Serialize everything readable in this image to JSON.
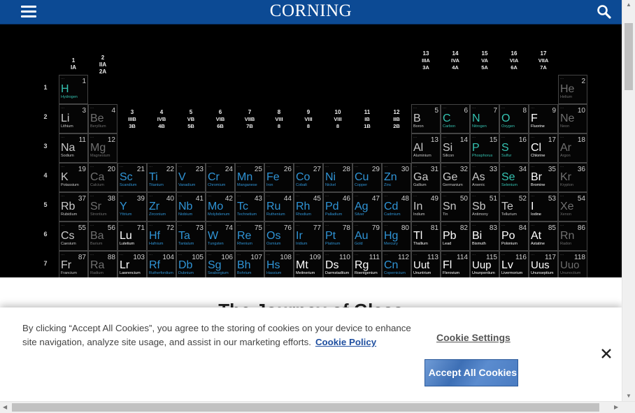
{
  "header": {
    "logo_text": "CORNING",
    "menu_icon": "hamburger-icon",
    "search_icon": "search-icon",
    "bar_color": "#0c4a94"
  },
  "periodic_table": {
    "colors": {
      "default": "#c9c9c9",
      "teal": "#35c3b2",
      "blue": "#2f94d6",
      "white": "#ffffff",
      "dim": "#6f6f6f"
    },
    "group_labels": [
      {
        "col": 1,
        "num": "1",
        "roman": "IA",
        "ab": "",
        "row": 0
      },
      {
        "col": 2,
        "num": "",
        "roman": "IIA",
        "ab": "2A",
        "row": 0
      },
      {
        "col": 3,
        "num": "3",
        "roman": "IIIB",
        "ab": "3B",
        "row": 2
      },
      {
        "col": 4,
        "num": "4",
        "roman": "IVB",
        "ab": "4B",
        "row": 2
      },
      {
        "col": 5,
        "num": "5",
        "roman": "VB",
        "ab": "5B",
        "row": 2
      },
      {
        "col": 6,
        "num": "6",
        "roman": "VIB",
        "ab": "6B",
        "row": 2
      },
      {
        "col": 7,
        "num": "7",
        "roman": "VIIB",
        "ab": "7B",
        "row": 2
      },
      {
        "col": 8,
        "num": "8",
        "roman": "VIII",
        "ab": "8",
        "row": 2
      },
      {
        "col": 9,
        "num": "9",
        "roman": "VIII",
        "ab": "8",
        "row": 2
      },
      {
        "col": 10,
        "num": "10",
        "roman": "VIII",
        "ab": "8",
        "row": 2
      },
      {
        "col": 11,
        "num": "11",
        "roman": "IB",
        "ab": "1B",
        "row": 2
      },
      {
        "col": 12,
        "num": "12",
        "roman": "IIB",
        "ab": "2B",
        "row": 2
      },
      {
        "col": 13,
        "num": "13",
        "roman": "IIIA",
        "ab": "3A",
        "row": 1
      },
      {
        "col": 14,
        "num": "14",
        "roman": "IVA",
        "ab": "4A",
        "row": 1
      },
      {
        "col": 15,
        "num": "15",
        "roman": "VA",
        "ab": "5A",
        "row": 1
      },
      {
        "col": 16,
        "num": "16",
        "roman": "VIA",
        "ab": "6A",
        "row": 1
      },
      {
        "col": 17,
        "num": "17",
        "roman": "VIIA",
        "ab": "7A",
        "row": 1
      }
    ],
    "period_labels": [
      "1",
      "2",
      "3",
      "4",
      "5",
      "6",
      "7"
    ],
    "elements": [
      {
        "sym": "H",
        "num": "1",
        "name": "Hydrogen",
        "r": 1,
        "c": 1,
        "t": "teal"
      },
      {
        "sym": "He",
        "num": "2",
        "name": "Helium",
        "r": 1,
        "c": 18,
        "t": "dim"
      },
      {
        "sym": "Li",
        "num": "3",
        "name": "Lithium",
        "r": 2,
        "c": 1,
        "t": "default"
      },
      {
        "sym": "Be",
        "num": "4",
        "name": "Beryllium",
        "r": 2,
        "c": 2,
        "t": "dim"
      },
      {
        "sym": "B",
        "num": "5",
        "name": "Boron",
        "r": 2,
        "c": 13,
        "t": "default"
      },
      {
        "sym": "C",
        "num": "6",
        "name": "Carbon",
        "r": 2,
        "c": 14,
        "t": "teal"
      },
      {
        "sym": "N",
        "num": "7",
        "name": "Nitrogen",
        "r": 2,
        "c": 15,
        "t": "teal"
      },
      {
        "sym": "O",
        "num": "8",
        "name": "Oxygen",
        "r": 2,
        "c": 16,
        "t": "teal"
      },
      {
        "sym": "F",
        "num": "9",
        "name": "Fluorine",
        "r": 2,
        "c": 17,
        "t": "white"
      },
      {
        "sym": "Ne",
        "num": "10",
        "name": "Neon",
        "r": 2,
        "c": 18,
        "t": "dim"
      },
      {
        "sym": "Na",
        "num": "11",
        "name": "Sodium",
        "r": 3,
        "c": 1,
        "t": "default"
      },
      {
        "sym": "Mg",
        "num": "12",
        "name": "Magnesium",
        "r": 3,
        "c": 2,
        "t": "dim"
      },
      {
        "sym": "Al",
        "num": "13",
        "name": "Aluminium",
        "r": 3,
        "c": 13,
        "t": "default"
      },
      {
        "sym": "Si",
        "num": "14",
        "name": "Silicon",
        "r": 3,
        "c": 14,
        "t": "default"
      },
      {
        "sym": "P",
        "num": "15",
        "name": "Phosphorus",
        "r": 3,
        "c": 15,
        "t": "teal"
      },
      {
        "sym": "S",
        "num": "16",
        "name": "Sulfur",
        "r": 3,
        "c": 16,
        "t": "teal"
      },
      {
        "sym": "Cl",
        "num": "17",
        "name": "Chlorine",
        "r": 3,
        "c": 17,
        "t": "white"
      },
      {
        "sym": "Ar",
        "num": "18",
        "name": "Argon",
        "r": 3,
        "c": 18,
        "t": "dim"
      },
      {
        "sym": "K",
        "num": "19",
        "name": "Potassium",
        "r": 4,
        "c": 1,
        "t": "default"
      },
      {
        "sym": "Ca",
        "num": "20",
        "name": "Calcium",
        "r": 4,
        "c": 2,
        "t": "dim"
      },
      {
        "sym": "Sc",
        "num": "21",
        "name": "Scandium",
        "r": 4,
        "c": 3,
        "t": "blue"
      },
      {
        "sym": "Ti",
        "num": "22",
        "name": "Titanium",
        "r": 4,
        "c": 4,
        "t": "blue"
      },
      {
        "sym": "V",
        "num": "23",
        "name": "Vanadium",
        "r": 4,
        "c": 5,
        "t": "blue"
      },
      {
        "sym": "Cr",
        "num": "24",
        "name": "Chromium",
        "r": 4,
        "c": 6,
        "t": "blue"
      },
      {
        "sym": "Mn",
        "num": "25",
        "name": "Manganese",
        "r": 4,
        "c": 7,
        "t": "blue"
      },
      {
        "sym": "Fe",
        "num": "26",
        "name": "Iron",
        "r": 4,
        "c": 8,
        "t": "blue"
      },
      {
        "sym": "Co",
        "num": "27",
        "name": "Cobalt",
        "r": 4,
        "c": 9,
        "t": "blue"
      },
      {
        "sym": "Ni",
        "num": "28",
        "name": "Nickel",
        "r": 4,
        "c": 10,
        "t": "blue"
      },
      {
        "sym": "Cu",
        "num": "29",
        "name": "Copper",
        "r": 4,
        "c": 11,
        "t": "blue"
      },
      {
        "sym": "Zn",
        "num": "30",
        "name": "Zinc",
        "r": 4,
        "c": 12,
        "t": "blue"
      },
      {
        "sym": "Ga",
        "num": "31",
        "name": "Gallium",
        "r": 4,
        "c": 13,
        "t": "default"
      },
      {
        "sym": "Ge",
        "num": "32",
        "name": "Germanium",
        "r": 4,
        "c": 14,
        "t": "default"
      },
      {
        "sym": "As",
        "num": "33",
        "name": "Arsenic",
        "r": 4,
        "c": 15,
        "t": "default"
      },
      {
        "sym": "Se",
        "num": "34",
        "name": "Selenium",
        "r": 4,
        "c": 16,
        "t": "teal"
      },
      {
        "sym": "Br",
        "num": "35",
        "name": "Bromine",
        "r": 4,
        "c": 17,
        "t": "white"
      },
      {
        "sym": "Kr",
        "num": "36",
        "name": "Krypton",
        "r": 4,
        "c": 18,
        "t": "dim"
      },
      {
        "sym": "Rb",
        "num": "37",
        "name": "Rubidium",
        "r": 5,
        "c": 1,
        "t": "default"
      },
      {
        "sym": "Sr",
        "num": "38",
        "name": "Strontium",
        "r": 5,
        "c": 2,
        "t": "dim"
      },
      {
        "sym": "Y",
        "num": "39",
        "name": "Yttrium",
        "r": 5,
        "c": 3,
        "t": "blue"
      },
      {
        "sym": "Zr",
        "num": "40",
        "name": "Zirconium",
        "r": 5,
        "c": 4,
        "t": "blue"
      },
      {
        "sym": "Nb",
        "num": "41",
        "name": "Niobium",
        "r": 5,
        "c": 5,
        "t": "blue"
      },
      {
        "sym": "Mo",
        "num": "42",
        "name": "Molybdenum",
        "r": 5,
        "c": 6,
        "t": "blue"
      },
      {
        "sym": "Tc",
        "num": "43",
        "name": "Technetium",
        "r": 5,
        "c": 7,
        "t": "blue"
      },
      {
        "sym": "Ru",
        "num": "44",
        "name": "Ruthenium",
        "r": 5,
        "c": 8,
        "t": "blue"
      },
      {
        "sym": "Rh",
        "num": "45",
        "name": "Rhodium",
        "r": 5,
        "c": 9,
        "t": "blue"
      },
      {
        "sym": "Pd",
        "num": "46",
        "name": "Palladium",
        "r": 5,
        "c": 10,
        "t": "blue"
      },
      {
        "sym": "Ag",
        "num": "47",
        "name": "Silver",
        "r": 5,
        "c": 11,
        "t": "blue"
      },
      {
        "sym": "Cd",
        "num": "48",
        "name": "Cadmium",
        "r": 5,
        "c": 12,
        "t": "blue"
      },
      {
        "sym": "In",
        "num": "49",
        "name": "Indium",
        "r": 5,
        "c": 13,
        "t": "default"
      },
      {
        "sym": "Sn",
        "num": "50",
        "name": "Tin",
        "r": 5,
        "c": 14,
        "t": "default"
      },
      {
        "sym": "Sb",
        "num": "51",
        "name": "Antimony",
        "r": 5,
        "c": 15,
        "t": "default"
      },
      {
        "sym": "Te",
        "num": "52",
        "name": "Tellurium",
        "r": 5,
        "c": 16,
        "t": "default"
      },
      {
        "sym": "I",
        "num": "53",
        "name": "Iodine",
        "r": 5,
        "c": 17,
        "t": "white"
      },
      {
        "sym": "Xe",
        "num": "54",
        "name": "Xenon",
        "r": 5,
        "c": 18,
        "t": "dim"
      },
      {
        "sym": "Cs",
        "num": "55",
        "name": "Caesium",
        "r": 6,
        "c": 1,
        "t": "default"
      },
      {
        "sym": "Ba",
        "num": "56",
        "name": "Barium",
        "r": 6,
        "c": 2,
        "t": "dim"
      },
      {
        "sym": "Lu",
        "num": "71",
        "name": "Lutetium",
        "r": 6,
        "c": 3,
        "t": "white"
      },
      {
        "sym": "Hf",
        "num": "72",
        "name": "Hafnium",
        "r": 6,
        "c": 4,
        "t": "blue"
      },
      {
        "sym": "Ta",
        "num": "73",
        "name": "Tantalum",
        "r": 6,
        "c": 5,
        "t": "blue"
      },
      {
        "sym": "W",
        "num": "74",
        "name": "Tungsten",
        "r": 6,
        "c": 6,
        "t": "blue"
      },
      {
        "sym": "Re",
        "num": "75",
        "name": "Rhenium",
        "r": 6,
        "c": 7,
        "t": "blue"
      },
      {
        "sym": "Os",
        "num": "76",
        "name": "Osmium",
        "r": 6,
        "c": 8,
        "t": "blue"
      },
      {
        "sym": "Ir",
        "num": "77",
        "name": "Iridium",
        "r": 6,
        "c": 9,
        "t": "blue"
      },
      {
        "sym": "Pt",
        "num": "78",
        "name": "Platinum",
        "r": 6,
        "c": 10,
        "t": "blue"
      },
      {
        "sym": "Au",
        "num": "79",
        "name": "Gold",
        "r": 6,
        "c": 11,
        "t": "blue"
      },
      {
        "sym": "Hg",
        "num": "80",
        "name": "Mercury",
        "r": 6,
        "c": 12,
        "t": "blue"
      },
      {
        "sym": "Tl",
        "num": "81",
        "name": "Thallium",
        "r": 6,
        "c": 13,
        "t": "white"
      },
      {
        "sym": "Pb",
        "num": "82",
        "name": "Lead",
        "r": 6,
        "c": 14,
        "t": "white"
      },
      {
        "sym": "Bi",
        "num": "83",
        "name": "Bismuth",
        "r": 6,
        "c": 15,
        "t": "white"
      },
      {
        "sym": "Po",
        "num": "84",
        "name": "Polonium",
        "r": 6,
        "c": 16,
        "t": "white"
      },
      {
        "sym": "At",
        "num": "85",
        "name": "Astatine",
        "r": 6,
        "c": 17,
        "t": "white"
      },
      {
        "sym": "Rn",
        "num": "86",
        "name": "Radon",
        "r": 6,
        "c": 18,
        "t": "dim"
      },
      {
        "sym": "Fr",
        "num": "87",
        "name": "Francium",
        "r": 7,
        "c": 1,
        "t": "default"
      },
      {
        "sym": "Ra",
        "num": "88",
        "name": "Radium",
        "r": 7,
        "c": 2,
        "t": "dim"
      },
      {
        "sym": "Lr",
        "num": "103",
        "name": "Lawrencium",
        "r": 7,
        "c": 3,
        "t": "white"
      },
      {
        "sym": "Rf",
        "num": "104",
        "name": "Rutherfordium",
        "r": 7,
        "c": 4,
        "t": "blue"
      },
      {
        "sym": "Db",
        "num": "105",
        "name": "Dubnium",
        "r": 7,
        "c": 5,
        "t": "blue"
      },
      {
        "sym": "Sg",
        "num": "106",
        "name": "Seaborgium",
        "r": 7,
        "c": 6,
        "t": "blue"
      },
      {
        "sym": "Bh",
        "num": "107",
        "name": "Bohrium",
        "r": 7,
        "c": 7,
        "t": "blue"
      },
      {
        "sym": "Hs",
        "num": "108",
        "name": "Hassium",
        "r": 7,
        "c": 8,
        "t": "blue"
      },
      {
        "sym": "Mt",
        "num": "109",
        "name": "Meitnerium",
        "r": 7,
        "c": 9,
        "t": "white"
      },
      {
        "sym": "Ds",
        "num": "110",
        "name": "Darmstadtium",
        "r": 7,
        "c": 10,
        "t": "white"
      },
      {
        "sym": "Rg",
        "num": "111",
        "name": "Roentgenium",
        "r": 7,
        "c": 11,
        "t": "white"
      },
      {
        "sym": "Cn",
        "num": "112",
        "name": "Copernicium",
        "r": 7,
        "c": 12,
        "t": "blue"
      },
      {
        "sym": "Uut",
        "num": "113",
        "name": "Ununtrium",
        "r": 7,
        "c": 13,
        "t": "white"
      },
      {
        "sym": "Fl",
        "num": "114",
        "name": "Flerovium",
        "r": 7,
        "c": 14,
        "t": "white"
      },
      {
        "sym": "Uup",
        "num": "115",
        "name": "Ununpentium",
        "r": 7,
        "c": 15,
        "t": "white"
      },
      {
        "sym": "Lv",
        "num": "116",
        "name": "Livermorium",
        "r": 7,
        "c": 16,
        "t": "white"
      },
      {
        "sym": "Uus",
        "num": "117",
        "name": "Ununseptium",
        "r": 7,
        "c": 17,
        "t": "white"
      },
      {
        "sym": "Uuo",
        "num": "118",
        "name": "Ununoctium",
        "r": 7,
        "c": 18,
        "t": "dim"
      }
    ]
  },
  "main": {
    "heading": "The Journey of Glass"
  },
  "cookie_banner": {
    "message": "By clicking “Accept All Cookies”, you agree to the storing of cookies on your device to enhance site navigation, analyze site usage, and assist in our marketing efforts.",
    "policy_link": "Cookie Policy",
    "settings_label": "Cookie Settings",
    "accept_label": "Accept All Cookies",
    "close_icon": "close-icon"
  }
}
